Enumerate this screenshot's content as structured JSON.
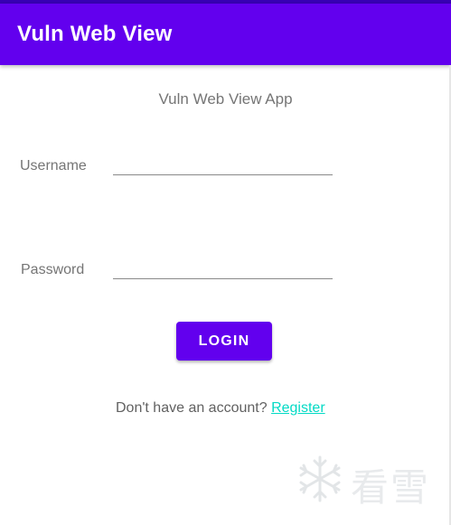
{
  "app_bar": {
    "title": "Vuln Web View"
  },
  "main": {
    "heading": "Vuln Web View App",
    "username": {
      "label": "Username",
      "value": "",
      "placeholder": ""
    },
    "password": {
      "label": "Password",
      "value": "",
      "placeholder": ""
    },
    "login_label": "LOGIN",
    "register_prompt": "Don't have an account? ",
    "register_link": "Register"
  },
  "watermark": {
    "icon": "snowflake-icon",
    "text": "看雪"
  },
  "colors": {
    "primary": "#6200ee",
    "primary_dark": "#3700b3",
    "accent": "#03dac5",
    "text_secondary": "#757575"
  }
}
